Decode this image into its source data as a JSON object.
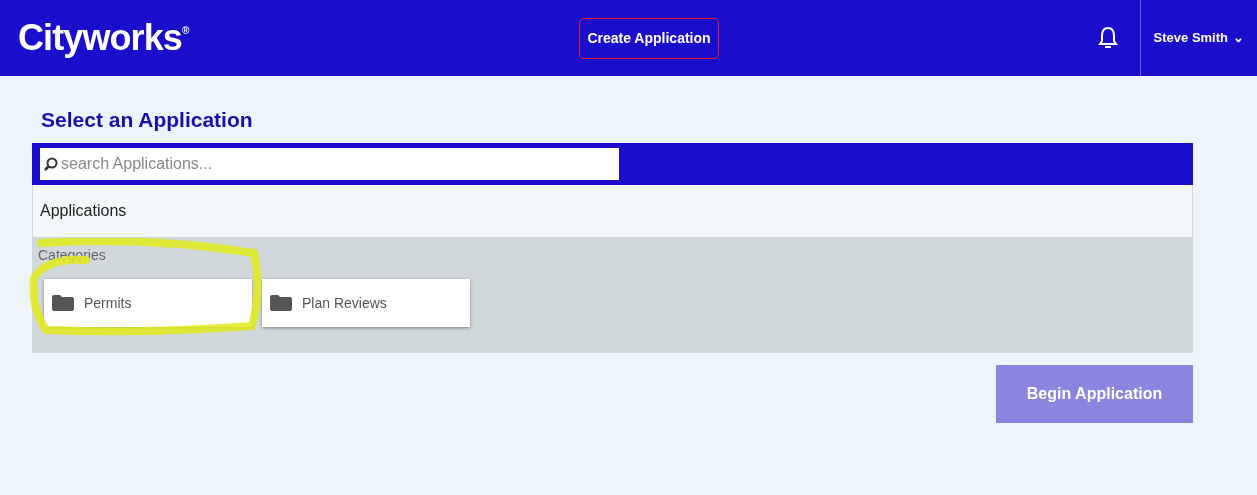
{
  "header": {
    "logo": "Cityworks$^{®}$",
    "create_button": "Create Application",
    "user": {
      "name": "Steve Smith",
      "caret": "⌄"
    }
  },
  "page": {
    "title": "Select an Application",
    "search": {
      "placeholder": "search Applications..."
    },
    "section_label": "Applications",
    "categories": {
      "label": "Categories",
      "items": [
        {
          "label": "Permits"
        },
        {
          "label": "Plan Reviews"
        }
      ]
    },
    "begin_button": {
      "label": "Begin Application",
      "disabled": true
    }
  }
}
